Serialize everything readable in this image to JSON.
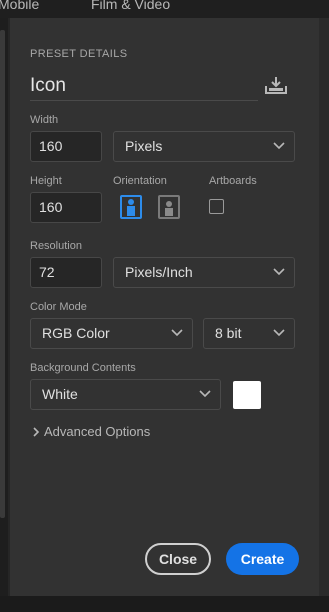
{
  "top_tabs": {
    "mobile": "Mobile",
    "film_video": "Film & Video"
  },
  "preset": {
    "section_label": "PRESET DETAILS",
    "name": "Icon",
    "save_icon": "save-preset-icon"
  },
  "width": {
    "label": "Width",
    "value": "160",
    "unit": "Pixels"
  },
  "height": {
    "label": "Height",
    "value": "160"
  },
  "orientation": {
    "label": "Orientation",
    "selected": "portrait",
    "portrait_icon": "portrait-icon",
    "landscape_icon": "landscape-icon"
  },
  "artboards": {
    "label": "Artboards",
    "checked": false
  },
  "resolution": {
    "label": "Resolution",
    "value": "72",
    "unit": "Pixels/Inch"
  },
  "color_mode": {
    "label": "Color Mode",
    "mode": "RGB Color",
    "depth": "8 bit"
  },
  "background": {
    "label": "Background Contents",
    "value": "White",
    "swatch_color": "#ffffff"
  },
  "advanced": {
    "label": "Advanced Options"
  },
  "buttons": {
    "close": "Close",
    "create": "Create"
  },
  "colors": {
    "accent": "#1473e6",
    "panel_bg": "#323232",
    "field_bg": "#262626"
  }
}
